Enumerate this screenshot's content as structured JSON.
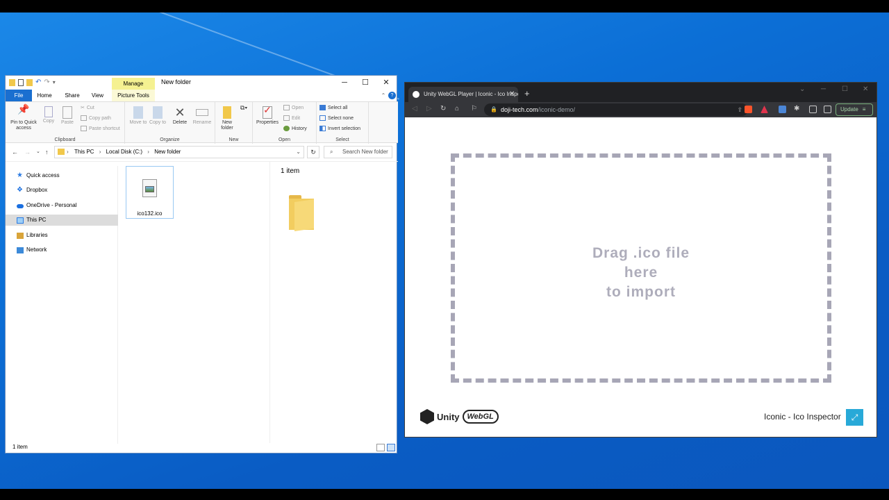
{
  "explorer": {
    "title": "New folder",
    "manage_tab": "Manage",
    "tabs": [
      "File",
      "Home",
      "Share",
      "View",
      "Picture Tools"
    ],
    "ribbon": {
      "clipboard": {
        "pin": "Pin to Quick access",
        "copy": "Copy",
        "paste": "Paste",
        "cut": "Cut",
        "copy_path": "Copy path",
        "paste_shortcut": "Paste shortcut",
        "label": "Clipboard"
      },
      "organize": {
        "move_to": "Move to",
        "copy_to": "Copy to",
        "delete": "Delete",
        "rename": "Rename",
        "label": "Organize"
      },
      "new": {
        "new_folder": "New folder",
        "label": "New"
      },
      "open": {
        "properties": "Properties",
        "open": "Open",
        "edit": "Edit",
        "history": "History",
        "label": "Open"
      },
      "select": {
        "select_all": "Select all",
        "select_none": "Select none",
        "invert": "Invert selection",
        "label": "Select"
      }
    },
    "breadcrumb": [
      "This PC",
      "Local Disk (C:)",
      "New folder"
    ],
    "search_placeholder": "Search New folder",
    "nav_items": [
      "Quick access",
      "Dropbox",
      "OneDrive - Personal",
      "This PC",
      "Libraries",
      "Network"
    ],
    "selected_nav": "This PC",
    "file_name": "ico132.ico",
    "preview_count": "1 item",
    "status": "1 item"
  },
  "browser": {
    "tab_title": "Unity WebGL Player | Iconic - Ico Inspector",
    "url_host": "doji-tech.com",
    "url_path": "/iconic-demo/",
    "update_label": "Update",
    "drop_lines": [
      "Drag .ico file",
      "here",
      "to import"
    ],
    "unity_label": "Unity",
    "webgl_label": "WebGL",
    "app_title": "Iconic - Ico Inspector"
  },
  "colors": {
    "accent": "#1a6fd0",
    "manage": "#f5f191",
    "drop_border": "#a7a6b6",
    "fullscreen": "#28a9d8",
    "desktop": "#0c6fd6"
  }
}
